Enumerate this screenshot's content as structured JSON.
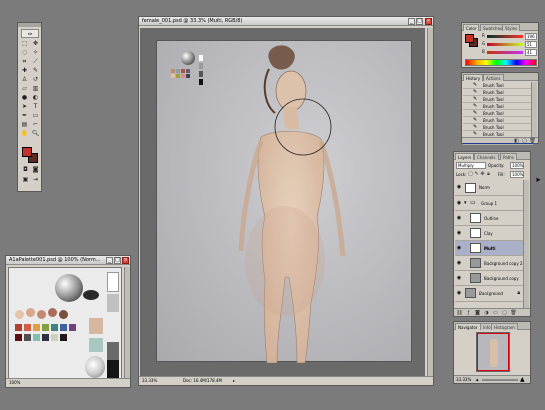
{
  "document": {
    "title": "female_001.psd @ 33.3% (Multi, RGB/8)",
    "zoom": "33.33%",
    "doc_size": "Doc: 16.4M/178.4M"
  },
  "swatch_doc": {
    "title": "A1aPalette001.psd @ 100% (Norm...",
    "zoom": "100%"
  },
  "color_panel": {
    "tabs": [
      "Color",
      "Swatches",
      "Styles"
    ],
    "channels": [
      {
        "label": "R",
        "value": "196"
      },
      {
        "label": "G",
        "value": "51"
      },
      {
        "label": "B",
        "value": "41"
      }
    ],
    "foreground": "#c43329",
    "background": "#5c2a20"
  },
  "history_panel": {
    "tabs": [
      "History",
      "Actions"
    ],
    "items": [
      "Brush Tool",
      "Brush Tool",
      "Brush Tool",
      "Brush Tool",
      "Brush Tool",
      "Brush Tool",
      "Brush Tool",
      "Brush Tool",
      "Brush Tool"
    ]
  },
  "layers_panel": {
    "tabs": [
      "Layers",
      "Channels",
      "Paths"
    ],
    "blend_mode": "Multiply",
    "opacity_label": "Opacity:",
    "opacity": "100%",
    "fill_label": "Fill:",
    "fill": "100%",
    "lock_label": "Lock:",
    "layers": [
      {
        "name": "Norm",
        "selected": false
      },
      {
        "name": "Group 1",
        "selected": false
      },
      {
        "name": "Outline",
        "selected": false
      },
      {
        "name": "Clay",
        "selected": false
      },
      {
        "name": "Multi",
        "selected": true
      },
      {
        "name": "Background copy 2",
        "selected": false
      },
      {
        "name": "Background copy",
        "selected": false
      },
      {
        "name": "Background",
        "selected": false
      }
    ]
  },
  "navigator_panel": {
    "tabs": [
      "Navigator",
      "Info",
      "Histogram"
    ],
    "zoom": "33.33%"
  }
}
